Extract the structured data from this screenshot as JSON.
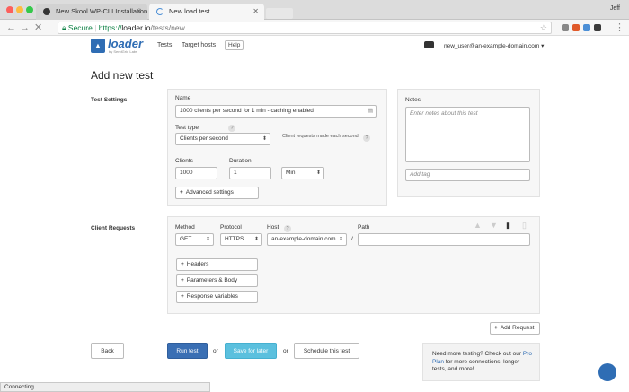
{
  "browser": {
    "tabs": [
      {
        "title": "New Skool WP-CLI Installation"
      },
      {
        "title": "New load test"
      }
    ],
    "user": "Jeff",
    "address": {
      "secure_label": "Secure",
      "scheme": "https://",
      "host": "loader.io",
      "path": "/tests/new"
    },
    "status": "Connecting..."
  },
  "header": {
    "logo": "loader",
    "logo_sub": "by SendGrid Labs",
    "nav": [
      "Tests",
      "Target hosts",
      "Help"
    ],
    "account": "new_user@an-example-domain.com ▾"
  },
  "page_title": "Add new test",
  "test_settings": {
    "section_label": "Test Settings",
    "name_label": "Name",
    "name_value": "1000 clients per second for 1 min - caching enabled",
    "test_type_label": "Test type",
    "hint": "?",
    "test_type_value": "Clients per second",
    "test_type_note": "Client requests made each second.",
    "clients_label": "Clients",
    "clients_value": "1000",
    "duration_label": "Duration",
    "duration_value": "1",
    "duration_unit": "Min",
    "advanced_button": "Advanced settings"
  },
  "notes": {
    "label": "Notes",
    "placeholder": "Enter notes about this test",
    "tag_placeholder": "Add tag"
  },
  "client_requests": {
    "section_label": "Client Requests",
    "method_label": "Method",
    "method_value": "GET",
    "protocol_label": "Protocol",
    "protocol_value": "HTTPS",
    "host_label": "Host",
    "host_hint": "?",
    "host_value": "an-example-domain.com",
    "path_label": "Path",
    "path_separator": "/",
    "path_value": "",
    "headers_button": "Headers",
    "params_button": "Parameters & Body",
    "response_vars_button": "Response variables",
    "add_request_button": "Add Request"
  },
  "actions": {
    "back": "Back",
    "run": "Run test",
    "or1": "or",
    "save_later": "Save for later",
    "or2": "or",
    "schedule": "Schedule this test"
  },
  "promo": {
    "line1": "Need more testing? Check out our",
    "link": "Pro Plan",
    "line2": " for more connections, longer tests, and more!"
  },
  "colors": {
    "primary": "#3a6fb4",
    "secondary": "#5bc0de",
    "brand": "#2f6db4",
    "secure_green": "#0b8043"
  }
}
